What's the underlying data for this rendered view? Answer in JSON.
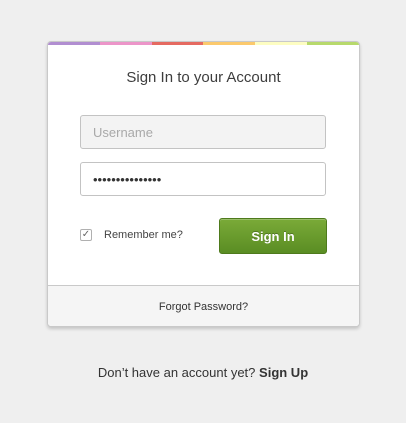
{
  "accent_stripe": [
    "#b18ed1",
    "#ec95c9",
    "#e56a61",
    "#fbc96d",
    "#fdfdc2",
    "#b7d96c"
  ],
  "login": {
    "title": "Sign In to your Account",
    "username_placeholder": "Username",
    "username_value": "",
    "password_value": "passwordpasswor",
    "remember_label": "Remember me?",
    "remember_checked": true,
    "remember_check_glyph": "✓",
    "signin_label": "Sign In",
    "signin_color": "#5f932a",
    "forgot_label": "Forgot Password?"
  },
  "signup": {
    "prompt": "Don’t have an account yet?",
    "link_label": "Sign Up"
  }
}
